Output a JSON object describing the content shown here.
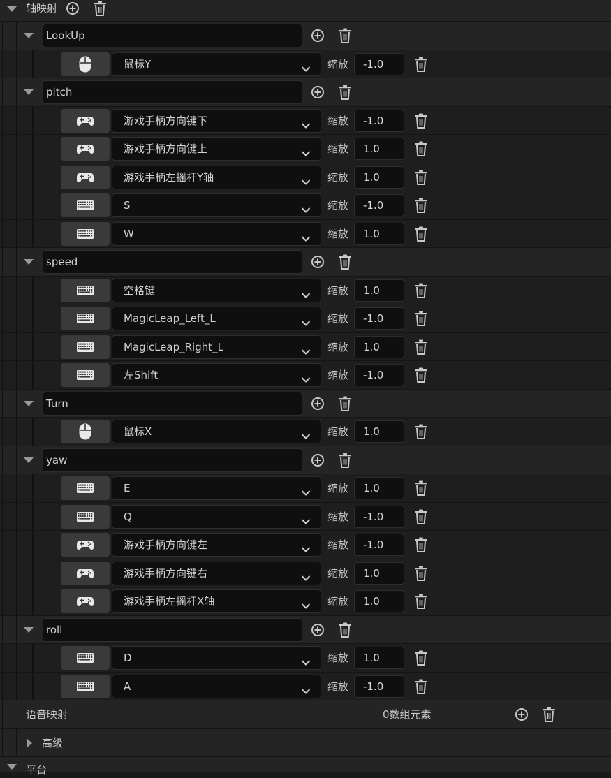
{
  "header": {
    "title": "轴映射"
  },
  "scale_label": "缩放",
  "groups": [
    {
      "name": "LookUp",
      "mappings": [
        {
          "device": "mouse-icon",
          "key": "鼠标Y",
          "scale": "-1.0"
        }
      ]
    },
    {
      "name": "pitch",
      "mappings": [
        {
          "device": "gamepad-icon",
          "key": "游戏手柄方向键下",
          "scale": "-1.0"
        },
        {
          "device": "gamepad-icon",
          "key": "游戏手柄方向键上",
          "scale": "1.0"
        },
        {
          "device": "gamepad-icon",
          "key": "游戏手柄左摇杆Y轴",
          "scale": "1.0"
        },
        {
          "device": "keyboard-icon",
          "key": "S",
          "scale": "-1.0"
        },
        {
          "device": "keyboard-icon",
          "key": "W",
          "scale": "1.0"
        }
      ]
    },
    {
      "name": "speed",
      "mappings": [
        {
          "device": "keyboard-icon",
          "key": "空格键",
          "scale": "1.0"
        },
        {
          "device": "keyboard-icon",
          "key": "MagicLeap_Left_L",
          "scale": "-1.0"
        },
        {
          "device": "keyboard-icon",
          "key": "MagicLeap_Right_L",
          "scale": "1.0"
        },
        {
          "device": "keyboard-icon",
          "key": "左Shift",
          "scale": "-1.0"
        }
      ]
    },
    {
      "name": "Turn",
      "mappings": [
        {
          "device": "mouse-icon",
          "key": "鼠标X",
          "scale": "1.0"
        }
      ]
    },
    {
      "name": "yaw",
      "mappings": [
        {
          "device": "keyboard-icon",
          "key": "E",
          "scale": "1.0"
        },
        {
          "device": "keyboard-icon",
          "key": "Q",
          "scale": "-1.0"
        },
        {
          "device": "gamepad-icon",
          "key": "游戏手柄方向键左",
          "scale": "-1.0"
        },
        {
          "device": "gamepad-icon",
          "key": "游戏手柄方向键右",
          "scale": "1.0"
        },
        {
          "device": "gamepad-icon",
          "key": "游戏手柄左摇杆X轴",
          "scale": "1.0"
        }
      ]
    },
    {
      "name": "roll",
      "mappings": [
        {
          "device": "keyboard-icon",
          "key": "D",
          "scale": "1.0"
        },
        {
          "device": "keyboard-icon",
          "key": "A",
          "scale": "-1.0"
        }
      ]
    }
  ],
  "speech": {
    "label": "语音映射",
    "count": "0数组元素"
  },
  "advanced": {
    "label": "高级"
  },
  "platform": {
    "label": "平台"
  }
}
